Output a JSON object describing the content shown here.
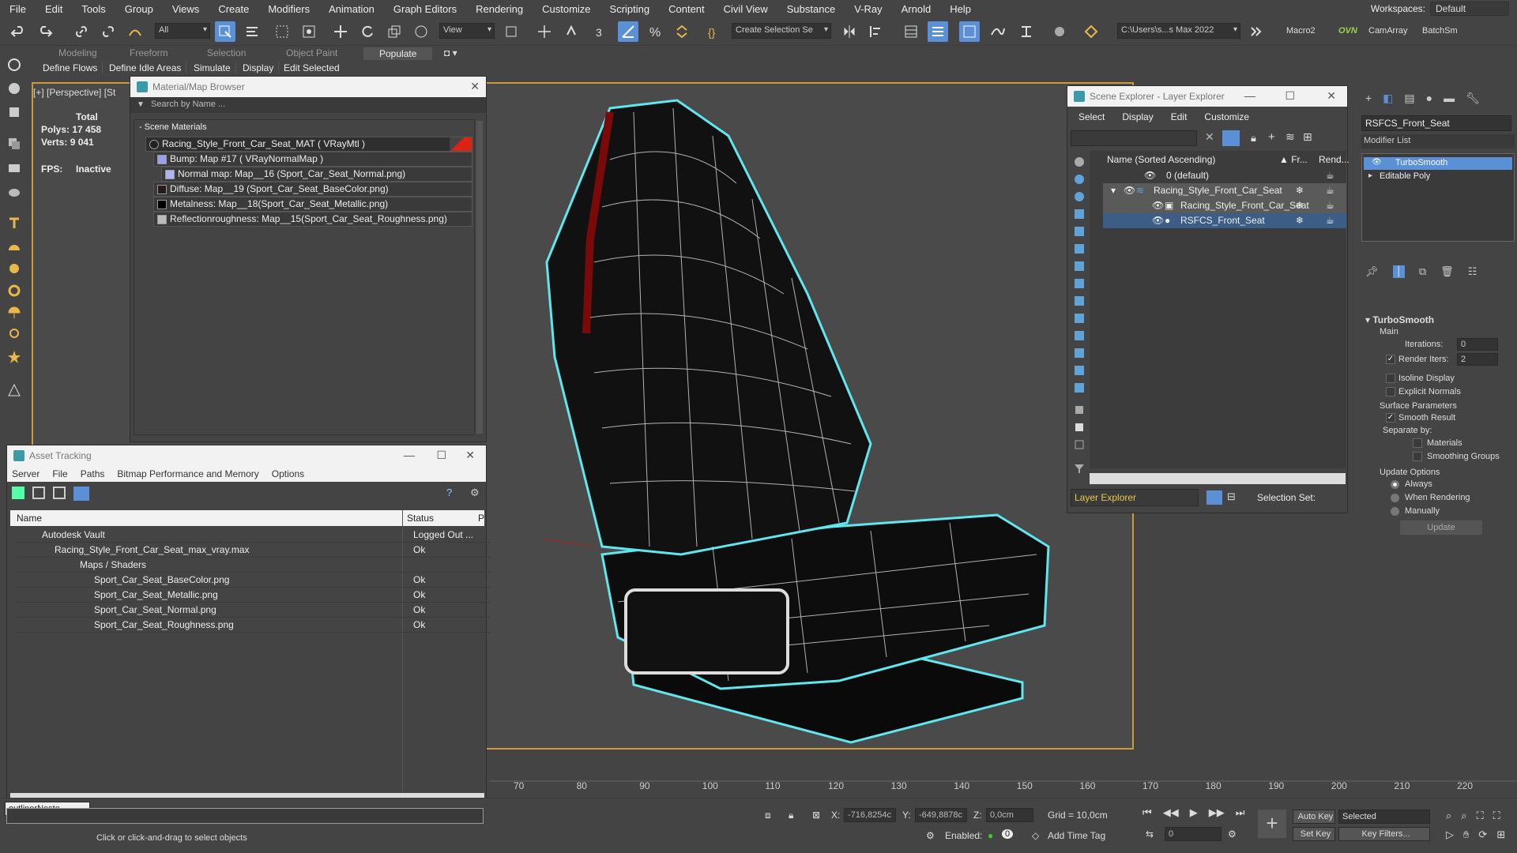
{
  "menu": {
    "items": [
      "File",
      "Edit",
      "Tools",
      "Group",
      "Views",
      "Create",
      "Modifiers",
      "Animation",
      "Graph Editors",
      "Rendering",
      "Customize",
      "Scripting",
      "Content",
      "Civil View",
      "Substance",
      "V-Ray",
      "Arnold",
      "Help"
    ],
    "workspaces_label": "Workspaces:",
    "workspace_value": "Default"
  },
  "toolbar": {
    "filter": "All",
    "view": "View",
    "selection_set": "Create Selection Se",
    "path": "C:\\Users\\s...s Max 2022",
    "macro": "Macro2",
    "ovn": "OVN",
    "camarray": "CamArray",
    "batchsm": "BatchSm"
  },
  "ribbon": {
    "tabs": [
      "Modeling",
      "Freeform",
      "Selection",
      "Object Paint",
      "Populate"
    ],
    "sub": [
      "Define Flows",
      "Define Idle Areas",
      "Simulate",
      "Display",
      "Edit Selected"
    ]
  },
  "viewport": {
    "label": "[+] [Perspective] [St",
    "stats": {
      "total_label": "Total",
      "polys_label": "Polys:",
      "polys": "17 458",
      "verts_label": "Verts:",
      "verts": "9 041",
      "fps_label": "FPS:",
      "fps": "Inactive"
    }
  },
  "material_browser": {
    "title": "Material/Map Browser",
    "search_placeholder": "Search by Name ...",
    "group": "- Scene Materials",
    "rows": [
      "Racing_Style_Front_Car_Seat_MAT  ( VRayMtl )",
      "Bump: Map #17  ( VRayNormalMap )",
      "Normal map: Map__16 (Sport_Car_Seat_Normal.png)",
      "Diffuse: Map__19 (Sport_Car_Seat_BaseColor.png)",
      "Metalness: Map__18(Sport_Car_Seat_Metallic.png)",
      "Reflectionroughness: Map__15(Sport_Car_Seat_Roughness.png)"
    ]
  },
  "asset_tracking": {
    "title": "Asset Tracking",
    "menu": [
      "Server",
      "File",
      "Paths",
      "Bitmap Performance and Memory",
      "Options"
    ],
    "col_name": "Name",
    "col_status": "Status",
    "col_p": "P",
    "rows": [
      {
        "name": "Autodesk Vault",
        "status": "Logged Out ..."
      },
      {
        "name": "Racing_Style_Front_Car_Seat_max_vray.max",
        "status": "Ok"
      },
      {
        "name": "Maps / Shaders",
        "status": ""
      },
      {
        "name": "Sport_Car_Seat_BaseColor.png",
        "status": "Ok"
      },
      {
        "name": "Sport_Car_Seat_Metallic.png",
        "status": "Ok"
      },
      {
        "name": "Sport_Car_Seat_Normal.png",
        "status": "Ok"
      },
      {
        "name": "Sport_Car_Seat_Roughness.png",
        "status": "Ok"
      }
    ]
  },
  "scene_explorer": {
    "title": "Scene Explorer - Layer Explorer",
    "menu": [
      "Select",
      "Display",
      "Edit",
      "Customize"
    ],
    "col_name": "Name (Sorted Ascending)",
    "col_fr": "▲ Fr...",
    "col_rend": "Rend...",
    "rows": [
      "0 (default)",
      "Racing_Style_Front_Car_Seat",
      "Racing_Style_Front_Car_Seat",
      "RSFCS_Front_Seat"
    ],
    "footer_layer": "Layer Explorer",
    "footer_selset": "Selection Set:"
  },
  "modifier": {
    "object_name": "RSFCS_Front_Seat",
    "list_label": "Modifier List",
    "stack": [
      "TurboSmooth",
      "Editable Poly"
    ],
    "rollout": "TurboSmooth",
    "main": "Main",
    "iterations_label": "Iterations:",
    "iterations": "0",
    "render_iters_label": "Render Iters:",
    "render_iters": "2",
    "isoline": "Isoline Display",
    "explicit": "Explicit Normals",
    "surface": "Surface Parameters",
    "smooth_result": "Smooth Result",
    "separate_by": "Separate by:",
    "materials": "Materials",
    "smoothing_groups": "Smoothing Groups",
    "update_options": "Update Options",
    "always": "Always",
    "when_rendering": "When Rendering",
    "manually": "Manually",
    "update_button": "Update"
  },
  "timeline": {
    "ticks": [
      "70",
      "80",
      "90",
      "100",
      "110",
      "120",
      "130",
      "140",
      "150",
      "160",
      "170",
      "180",
      "190",
      "200",
      "210",
      "220"
    ]
  },
  "status": {
    "script_listener": "outlinerNeste",
    "prompt": "Click or click-and-drag to select objects",
    "x_label": "X:",
    "x": "-716,8254c",
    "y_label": "Y:",
    "y": "-649,8878c",
    "z_label": "Z:",
    "z": "0,0cm",
    "grid": "Grid = 10,0cm",
    "enabled": "Enabled:",
    "add_time_tag": "Add Time Tag",
    "auto_key": "Auto Key",
    "selected": "Selected",
    "set_key": "Set Key",
    "key_filters": "Key Filters...",
    "frame": "0"
  }
}
